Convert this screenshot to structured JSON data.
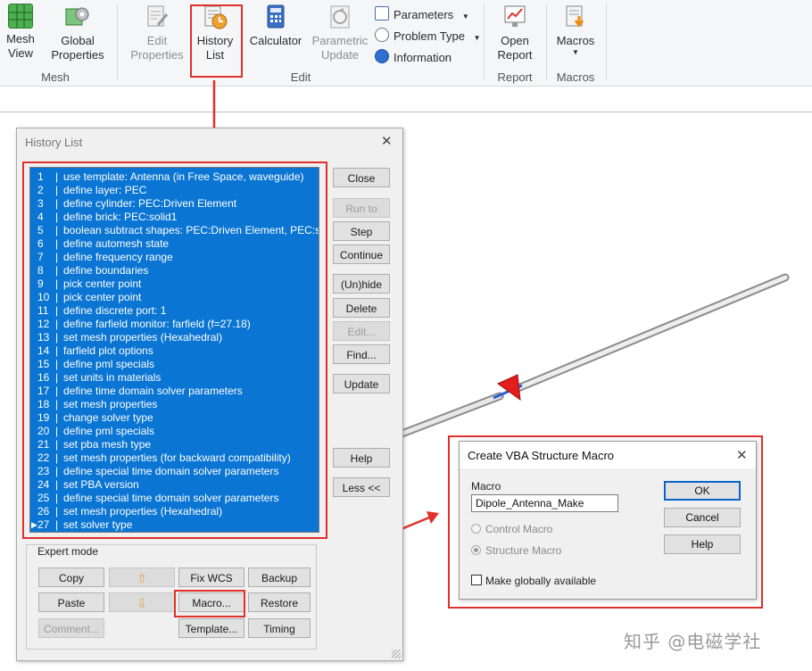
{
  "ribbon": {
    "mesh_group": {
      "label": "Mesh",
      "mesh_view": "Mesh\nView",
      "global_properties": "Global\nProperties"
    },
    "edit_group": {
      "label": "Edit",
      "edit_properties": "Edit\nProperties",
      "history_list": "History\nList",
      "calculator": "Calculator",
      "parametric_update": "Parametric\nUpdate",
      "parameters": "Parameters",
      "problem_type": "Problem Type",
      "information": "Information"
    },
    "report_group": {
      "label": "Report",
      "open_report": "Open\nReport"
    },
    "macros_group": {
      "label": "Macros",
      "macros": "Macros"
    }
  },
  "history_window": {
    "title": "History List",
    "entries": [
      {
        "num": "1",
        "text": "use template: Antenna (in Free Space, waveguide)"
      },
      {
        "num": "2",
        "text": "define layer: PEC"
      },
      {
        "num": "3",
        "text": "define cylinder: PEC:Driven Element"
      },
      {
        "num": "4",
        "text": "define brick: PEC:solid1"
      },
      {
        "num": "5",
        "text": "boolean subtract shapes: PEC:Driven Element, PEC:s"
      },
      {
        "num": "6",
        "text": "define automesh state"
      },
      {
        "num": "7",
        "text": "define frequency range"
      },
      {
        "num": "8",
        "text": "define boundaries"
      },
      {
        "num": "9",
        "text": "pick center point"
      },
      {
        "num": "10",
        "text": "pick center point"
      },
      {
        "num": "11",
        "text": "define discrete port: 1"
      },
      {
        "num": "12",
        "text": "define farfield monitor: farfield (f=27.18)"
      },
      {
        "num": "13",
        "text": "set mesh properties (Hexahedral)"
      },
      {
        "num": "14",
        "text": "farfield plot options"
      },
      {
        "num": "15",
        "text": "define pml specials"
      },
      {
        "num": "16",
        "text": "set units in materials"
      },
      {
        "num": "17",
        "text": "define time domain solver parameters"
      },
      {
        "num": "18",
        "text": "set mesh properties"
      },
      {
        "num": "19",
        "text": "change solver type"
      },
      {
        "num": "20",
        "text": "define pml specials"
      },
      {
        "num": "21",
        "text": "set pba mesh type"
      },
      {
        "num": "22",
        "text": "set mesh properties (for backward compatibility)"
      },
      {
        "num": "23",
        "text": "define special time domain solver parameters"
      },
      {
        "num": "24",
        "text": "set PBA version"
      },
      {
        "num": "25",
        "text": "define special time domain solver parameters"
      },
      {
        "num": "26",
        "text": "set mesh properties (Hexahedral)"
      },
      {
        "num": "27",
        "text": "set solver type"
      }
    ],
    "buttons": {
      "close": "Close",
      "run_to": "Run to",
      "step": "Step",
      "continue": "Continue",
      "unhide": "(Un)hide",
      "delete": "Delete",
      "edit": "Edit...",
      "find": "Find...",
      "update": "Update",
      "help": "Help",
      "less": "Less <<"
    },
    "expert_mode": {
      "label": "Expert mode",
      "copy": "Copy",
      "paste": "Paste",
      "comment": "Comment...",
      "fix_wcs": "Fix WCS",
      "macro": "Macro...",
      "template": "Template...",
      "backup": "Backup",
      "restore": "Restore",
      "timing": "Timing"
    }
  },
  "macro_dialog": {
    "title": "Create VBA Structure Macro",
    "macro_label": "Macro",
    "macro_name": "Dipole_Antenna_Make",
    "control_macro": "Control Macro",
    "structure_macro": "Structure Macro",
    "make_global": "Make globally available",
    "ok": "OK",
    "cancel": "Cancel",
    "help": "Help"
  },
  "watermark": "知乎 @电磁学社",
  "colors": {
    "selection": "#0a75d3",
    "annotation": "#e0302b",
    "default_button_border": "#0a63c8"
  }
}
